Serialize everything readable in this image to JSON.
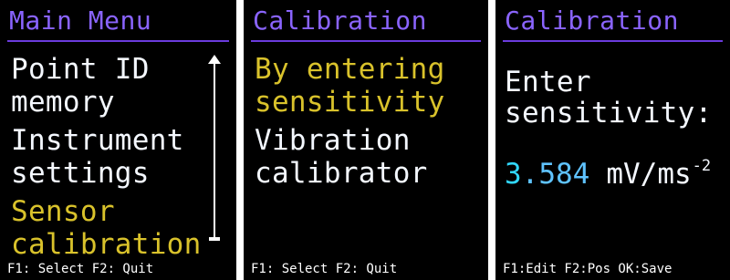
{
  "colors": {
    "title": "#8a64ff",
    "title_rule": "#6a3bdc",
    "text": "#f4f8ff",
    "highlight": "#d9c22b",
    "value_first": "#31d8ff",
    "value_rest": "#5fc3ff"
  },
  "screen1": {
    "title": "Main Menu",
    "items": [
      {
        "line1": "Point ID",
        "line2": "memory",
        "selected": false
      },
      {
        "line1": "Instrument",
        "line2": "settings",
        "selected": false
      },
      {
        "line1": "Sensor",
        "line2": "calibration",
        "selected": true
      }
    ],
    "footer": "F1: Select  F2: Quit",
    "scroll_icon": "scroll-up-arrow"
  },
  "screen2": {
    "title": "Calibration",
    "items": [
      {
        "line1": "By entering",
        "line2": "sensitivity",
        "selected": true
      },
      {
        "line1": "Vibration",
        "line2": "calibrator",
        "selected": false
      }
    ],
    "footer": "F1: Select  F2: Quit"
  },
  "screen3": {
    "title": "Calibration",
    "prompt_line1": "Enter",
    "prompt_line2": "sensitivity:",
    "value_cursor_digit": "3",
    "value_rest": ".584",
    "unit": "mV/ms",
    "unit_exponent": "-2",
    "footer": "F1:Edit F2:Pos OK:Save"
  }
}
